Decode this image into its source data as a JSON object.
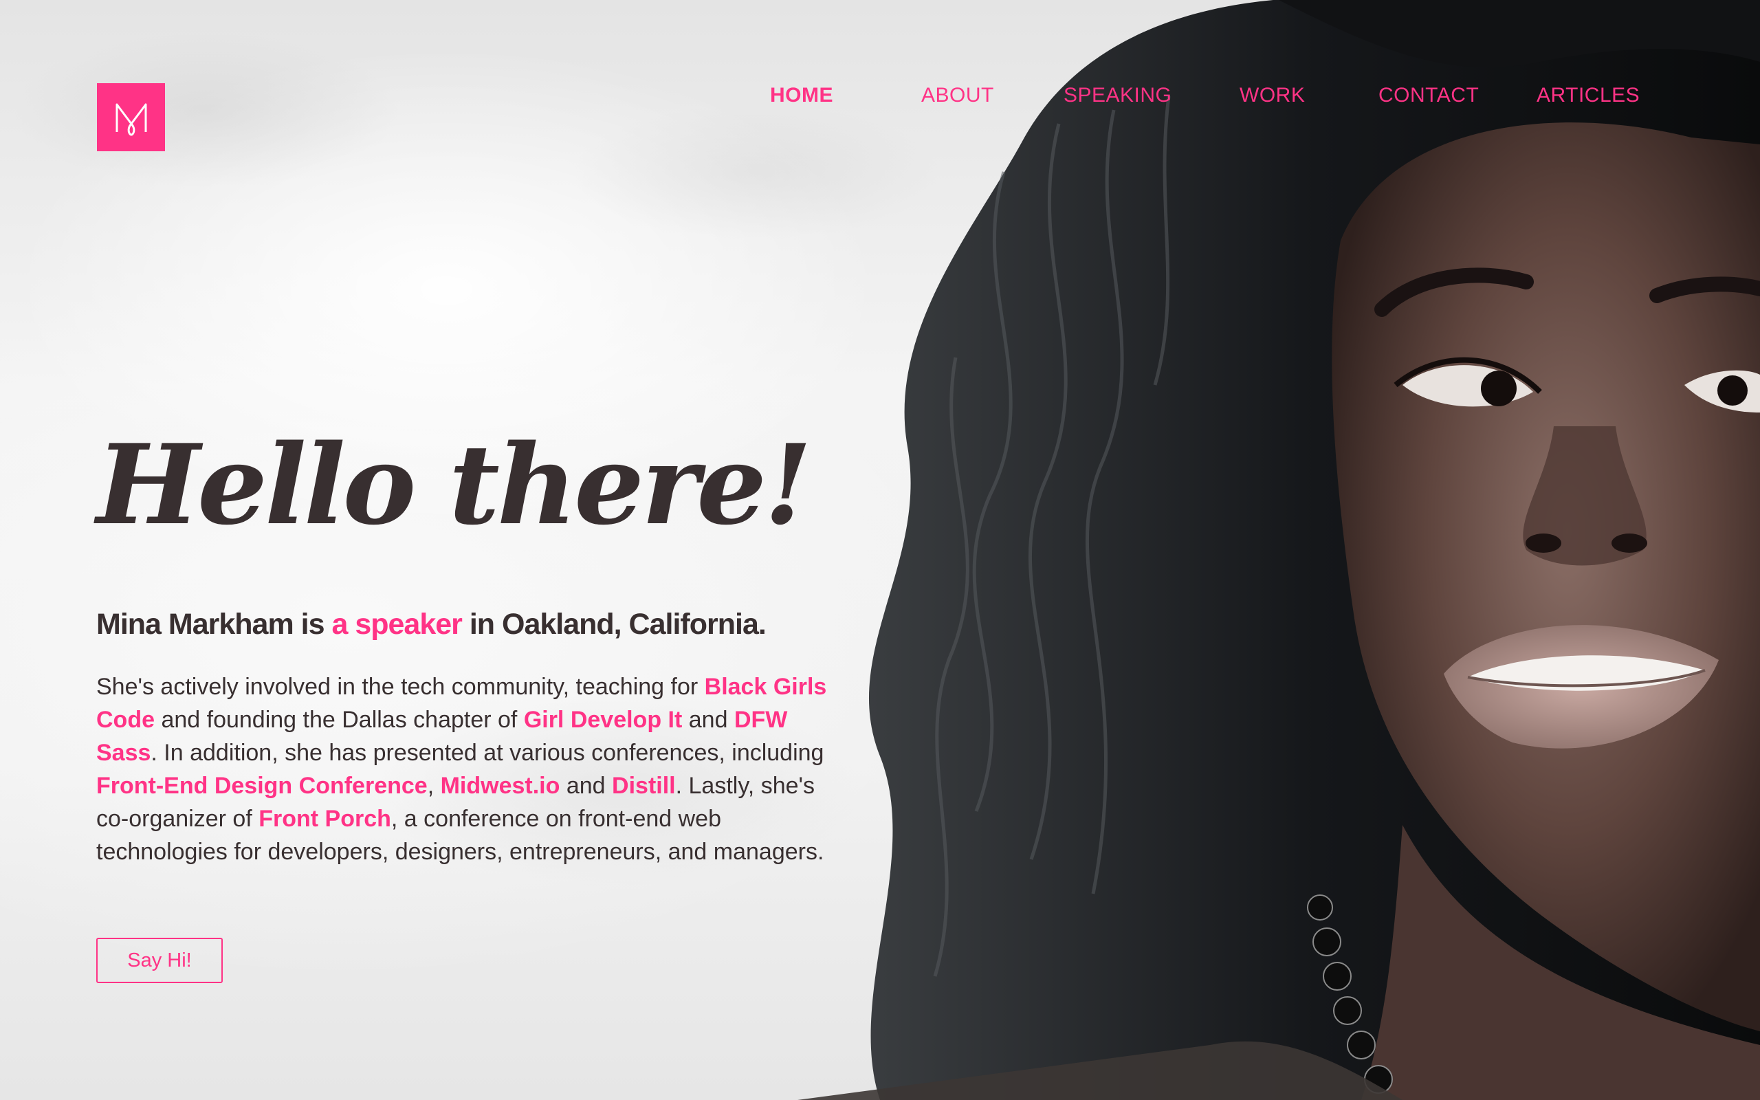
{
  "brand": {
    "logo_letter": "M",
    "accent_color": "#ff3386",
    "text_color": "#382f30"
  },
  "nav": {
    "items": [
      {
        "label": "HOME",
        "active": true
      },
      {
        "label": "ABOUT",
        "active": false
      },
      {
        "label": "SPEAKING",
        "active": false
      },
      {
        "label": "WORK",
        "active": false
      },
      {
        "label": "CONTACT",
        "active": false
      },
      {
        "label": "ARTICLES",
        "active": false
      }
    ]
  },
  "hero": {
    "heading": "Hello there!",
    "tagline_prefix": "Mina Markham is ",
    "tagline_link": "a speaker",
    "tagline_suffix": " in Oakland, California.",
    "bio": {
      "t1": "She's actively involved in the tech community, teaching for ",
      "l1": "Black Girls Code",
      "t2": " and founding the Dallas chapter of ",
      "l2": "Girl Develop It",
      "t3": " and ",
      "l3": "DFW Sass",
      "t4": ". In addition, she has presented at various conferences, including ",
      "l4": "Front-End Design Conference",
      "t5": ", ",
      "l5": "Midwest.io",
      "t6": " and ",
      "l6": "Distill",
      "t7": ". Lastly, she's co-organizer of ",
      "l7": "Front Porch",
      "t8": ", a conference on front-end web technologies for developers, designers, entrepreneurs, and managers."
    },
    "cta_label": "Say Hi!"
  },
  "portrait": {
    "icon": "portrait-photo"
  }
}
